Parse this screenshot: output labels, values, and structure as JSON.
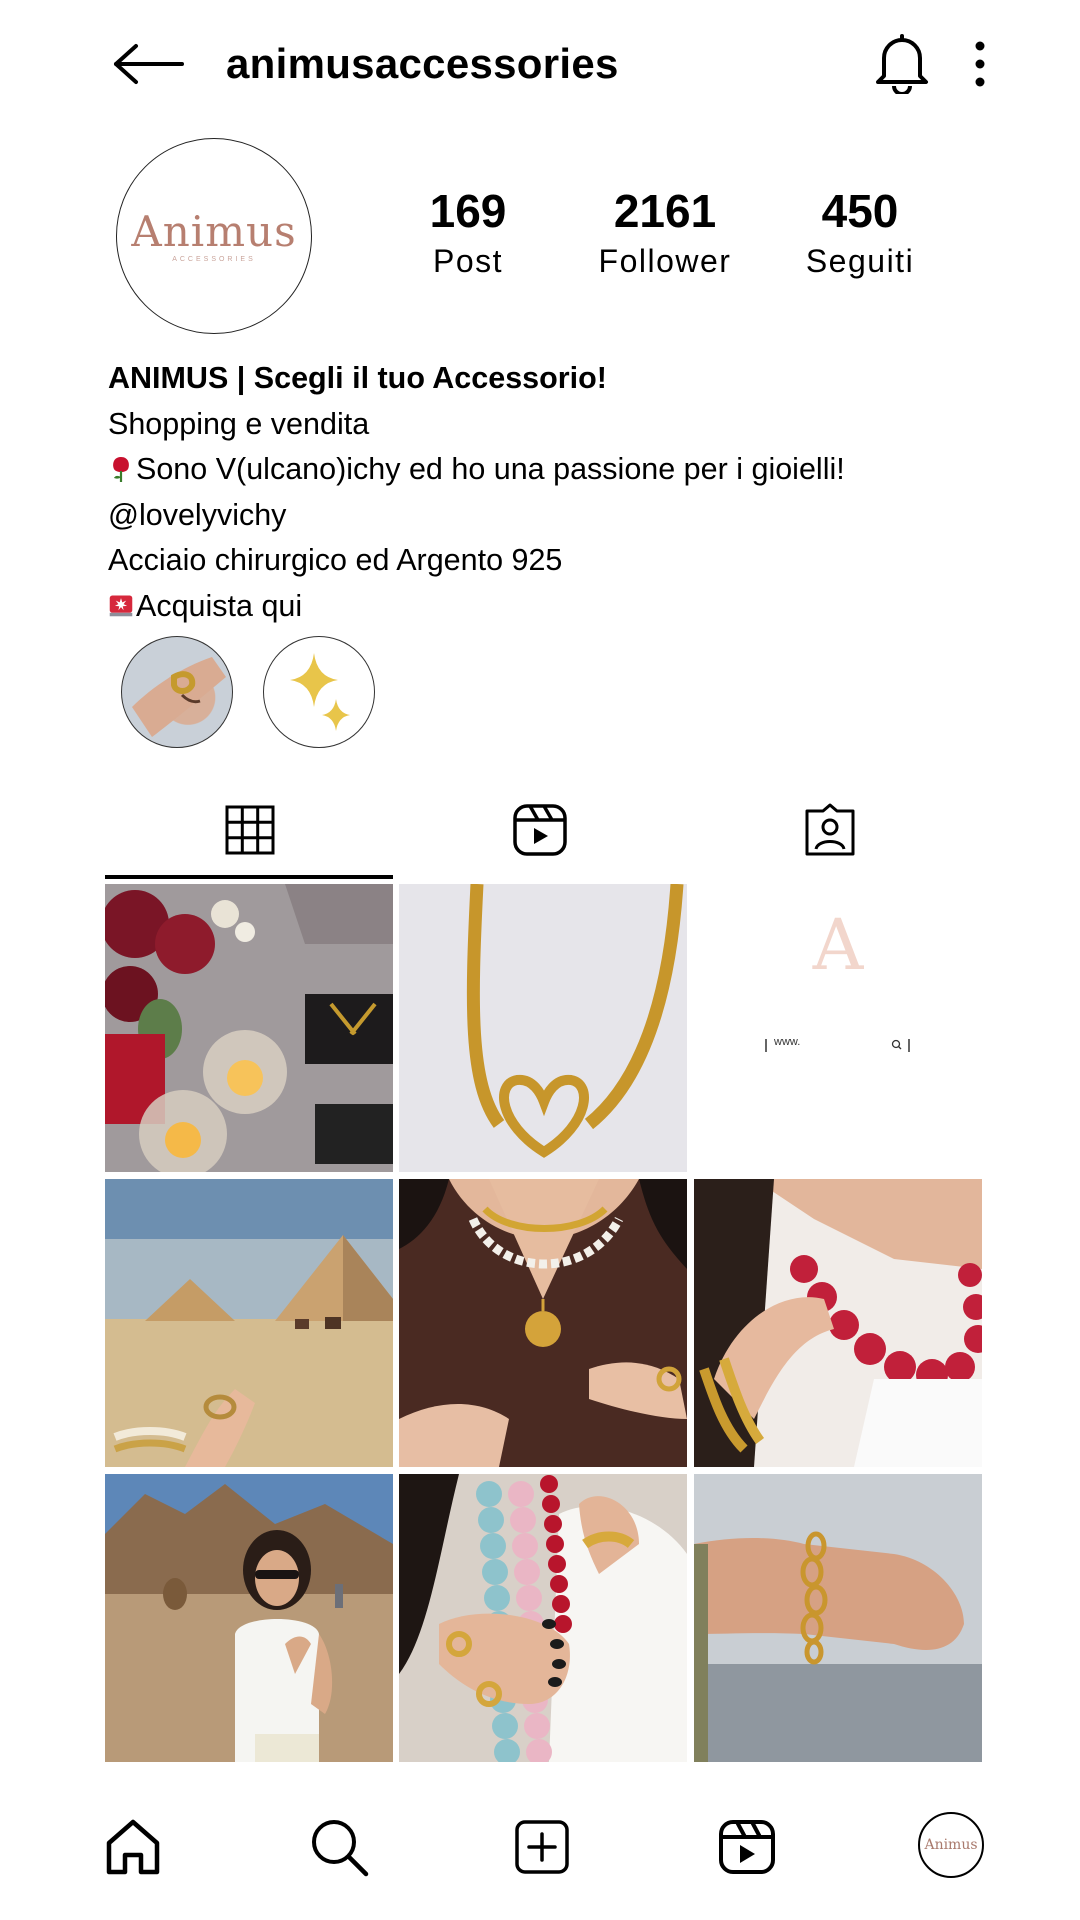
{
  "header": {
    "username": "animusaccessories",
    "back_icon": "back-arrow-icon",
    "bell_icon": "bell-icon",
    "more_icon": "more-vertical-icon"
  },
  "profile": {
    "avatar_brand": "Animus",
    "avatar_subtext": "ACCESSORIES",
    "stats": {
      "posts": {
        "value": "169",
        "label": "Post"
      },
      "followers": {
        "value": "2161",
        "label": "Follower"
      },
      "following": {
        "value": "450",
        "label": "Seguiti"
      }
    },
    "bio": {
      "name": "ANIMUS | Scegli il tuo Accessorio!",
      "category": "Shopping e vendita",
      "line1": "Sono V(ulcano)ichy ed ho una passione per i gioielli!",
      "mention": "@lovelyvichy",
      "line2": "Acciaio chirurgico ed Argento 925",
      "cta": "Acquista qui"
    }
  },
  "tabs": [
    {
      "name": "posts-grid",
      "icon": "grid-icon",
      "active": true
    },
    {
      "name": "reels",
      "icon": "reels-icon",
      "active": false
    },
    {
      "name": "tagged",
      "icon": "tagged-user-icon",
      "active": false
    }
  ],
  "grid": [
    {
      "alt": "candles and roses"
    },
    {
      "alt": "gold heart necklace"
    },
    {
      "alt": "logo post",
      "logo_letter": "A",
      "url_text": "www."
    },
    {
      "alt": "ring at pyramids"
    },
    {
      "alt": "layered necklaces"
    },
    {
      "alt": "red bead necklace"
    },
    {
      "alt": "woman in desert"
    },
    {
      "alt": "bead strands"
    },
    {
      "alt": "gold chain bracelet"
    }
  ],
  "bottom_nav": {
    "items": [
      "home-icon",
      "search-icon",
      "create-icon",
      "reels-icon"
    ],
    "profile_label": "Animus"
  },
  "colors": {
    "brand": "#b77f70",
    "rose": "#c8102e",
    "gold": "#c9962e"
  }
}
